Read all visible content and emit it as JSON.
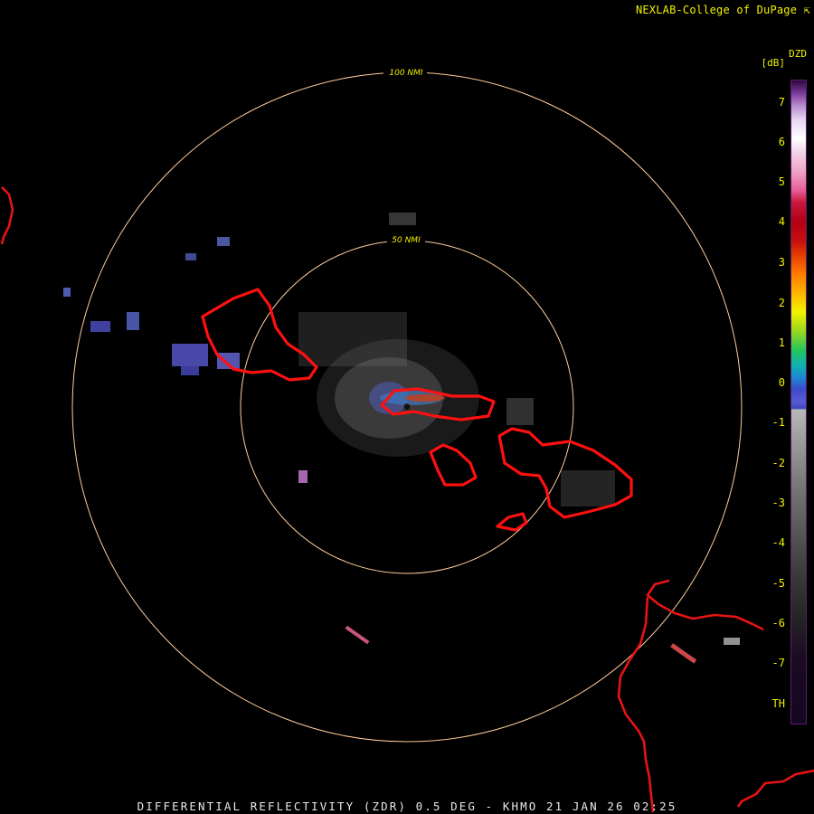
{
  "credit": "NEXLAB-College of DuPage ⇱",
  "footer": "DIFFERENTIAL REFLECTIVITY (ZDR) 0.5 DEG - KHMO 21 JAN 26 02:25",
  "legend": {
    "title": "DZD",
    "unit": "[dB]",
    "ticks": [
      "7",
      "6",
      "5",
      "4",
      "3",
      "2",
      "1",
      "0",
      "-1",
      "-2",
      "-3",
      "-4",
      "-5",
      "-6",
      "-7",
      "TH"
    ]
  },
  "range_rings": [
    {
      "label": "50 NMI",
      "nmi": 50
    },
    {
      "label": "100 NMI",
      "nmi": 100
    }
  ],
  "colors": {
    "ring": "#ffcc99",
    "warning_outline": "#ff1010",
    "coastline": "#e61414",
    "label_yellow": "#f2f200",
    "background": "#000000"
  }
}
